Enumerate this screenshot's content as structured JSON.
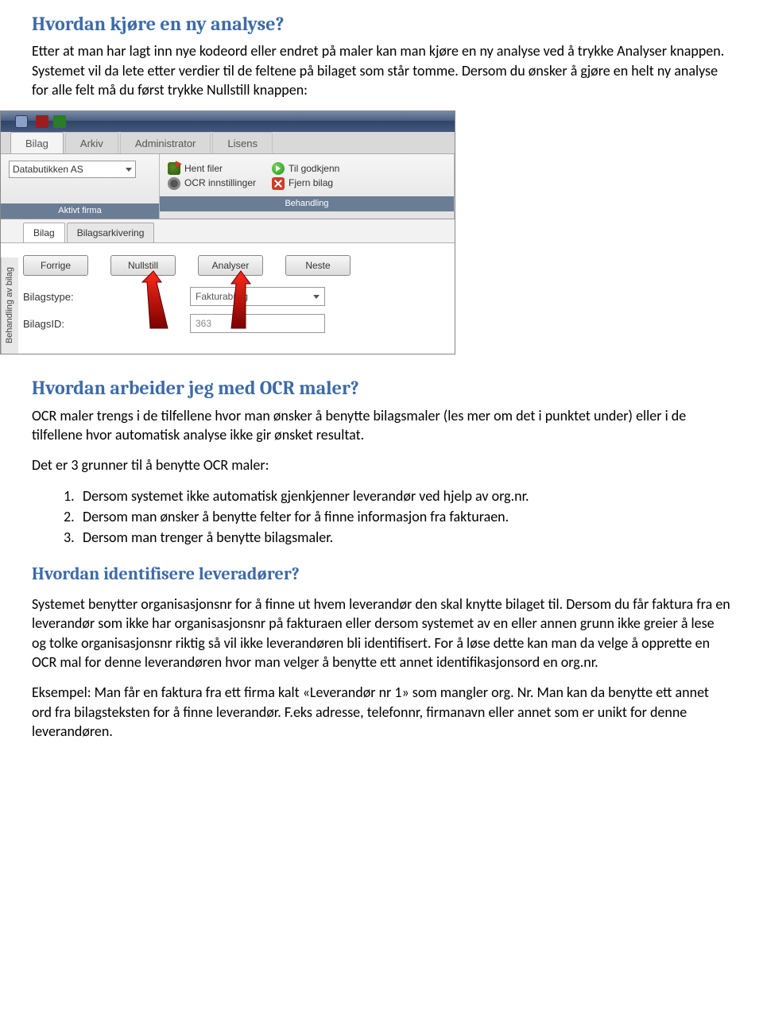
{
  "h1": "Hvordan kjøre en ny analyse?",
  "p1": "Etter at man har lagt inn nye kodeord eller endret på maler kan man kjøre en ny analyse ved å trykke Analyser knappen. Systemet vil da lete etter verdier til de feltene på bilaget som står tomme. Dersom du ønsker å gjøre en helt ny analyse for alle felt må du først trykke Nullstill knappen:",
  "app": {
    "ribbon_tabs": [
      "Bilag",
      "Arkiv",
      "Administrator",
      "Lisens"
    ],
    "company": "Databutikken AS",
    "actions": {
      "hent": "Hent filer",
      "ocr": "OCR innstillinger",
      "godkjenn": "Til godkjenn",
      "fjern": "Fjern bilag"
    },
    "group1": "Aktivt firma",
    "group2": "Behandling",
    "subtabs": [
      "Bilag",
      "Bilagsarkivering"
    ],
    "side": "Behandling av bilag",
    "buttons": {
      "forrige": "Forrige",
      "nullstill": "Nullstill",
      "analyser": "Analyser",
      "neste": "Neste"
    },
    "fields": {
      "type_label": "Bilagstype:",
      "type_value": "Fakturabilag",
      "id_label": "BilagsID:",
      "id_value": "363"
    }
  },
  "h2": "Hvordan arbeider jeg med OCR maler?",
  "p2": "OCR maler trengs i de tilfellene hvor man ønsker å benytte bilagsmaler (les mer om det i punktet under) eller i de tilfellene hvor automatisk analyse ikke gir ønsket resultat.",
  "p3": "Det er 3 grunner til å benytte OCR maler:",
  "list": [
    "Dersom systemet ikke automatisk gjenkjenner leverandør ved hjelp av org.nr.",
    "Dersom man ønsker å benytte felter for å finne informasjon fra fakturaen.",
    "Dersom man trenger å benytte bilagsmaler."
  ],
  "h3": "Hvordan identifisere leveradører?",
  "p4": "Systemet benytter organisasjonsnr for å finne ut hvem leverandør den skal knytte bilaget til. Dersom du får faktura fra en leverandør som ikke har organisasjonsnr på fakturaen eller dersom systemet av en eller annen grunn ikke greier å lese og tolke organisasjonsnr riktig så vil ikke leverandøren bli identifisert. For å løse dette kan man da velge å opprette en OCR mal for denne leverandøren hvor man velger å benytte ett annet identifikasjonsord en org.nr.",
  "p5": "Eksempel: Man får en faktura fra ett firma kalt «Leverandør nr 1» som mangler org. Nr. Man kan da benytte ett annet ord fra bilagsteksten for å finne leverandør. F.eks adresse, telefonnr, firmanavn eller annet som er unikt for denne leverandøren."
}
